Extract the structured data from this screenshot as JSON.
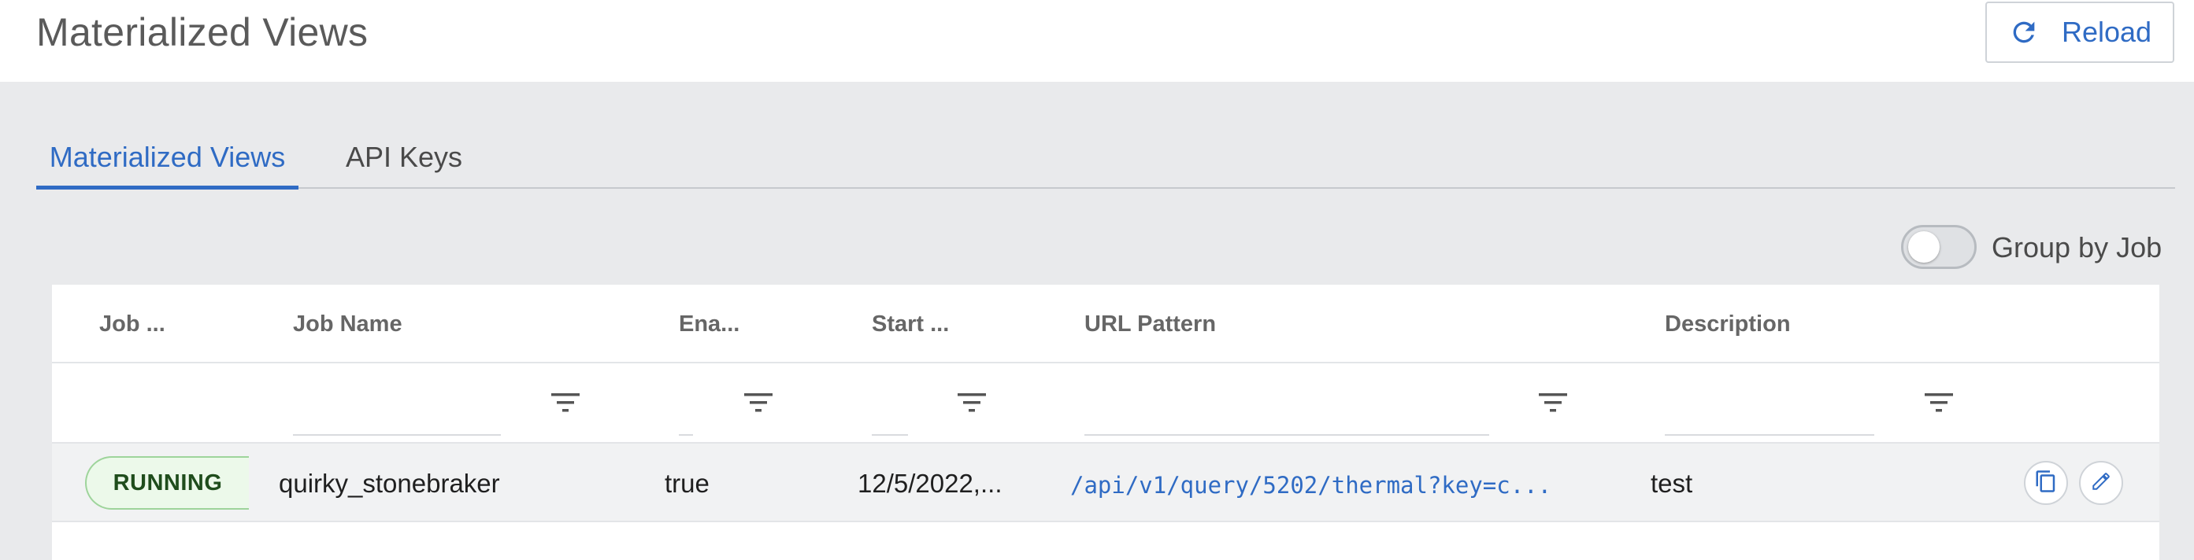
{
  "header": {
    "title": "Materialized Views",
    "reload_label": "Reload",
    "reload_icon": "refresh-icon"
  },
  "tabs": [
    {
      "label": "Materialized Views",
      "active": true
    },
    {
      "label": "API Keys",
      "active": false
    }
  ],
  "toolbar": {
    "group_by_job_label": "Group by Job",
    "group_by_job_enabled": false
  },
  "table": {
    "columns": [
      "Job ...",
      "Job Name",
      "Ena...",
      "Start ...",
      "URL Pattern",
      "Description"
    ],
    "rows": [
      {
        "status": "RUNNING",
        "job_name": "quirky_stonebraker",
        "enabled": "true",
        "start": "12/5/2022,...",
        "url_pattern": "/api/v1/query/5202/thermal?key=c...",
        "description": "test",
        "actions": [
          "copy-icon",
          "edit-icon"
        ]
      }
    ]
  },
  "colors": {
    "accent": "#2f6bc4",
    "running_bg": "#ecf9ea",
    "running_border": "#9ed49b",
    "running_text": "#1f4d1c"
  }
}
